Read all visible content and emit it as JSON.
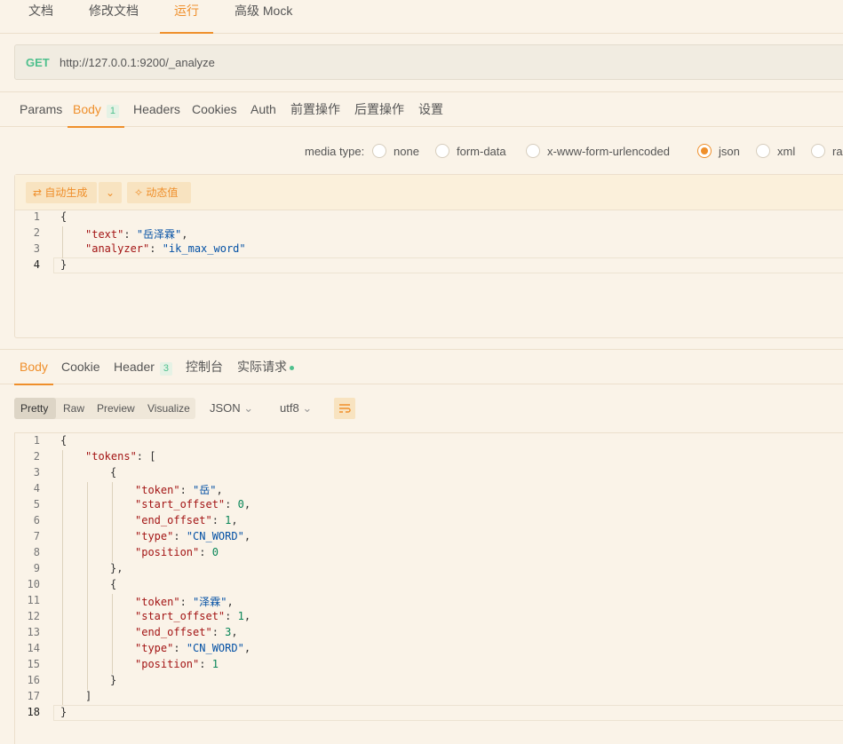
{
  "top_tabs": [
    "文档",
    "修改文档",
    "运行",
    "高级 Mock"
  ],
  "url_bar": {
    "method": "GET",
    "url": "http://127.0.0.1:9200/_analyze"
  },
  "request_tabs": {
    "params": "Params",
    "body": "Body",
    "body_count": "1",
    "headers": "Headers",
    "cookies": "Cookies",
    "auth": "Auth",
    "pre": "前置操作",
    "post": "后置操作",
    "settings": "设置"
  },
  "media_type": {
    "label": "media type:",
    "options": [
      "none",
      "form-data",
      "x-www-form-urlencoded",
      "json",
      "xml",
      "ra"
    ],
    "selected": "json"
  },
  "editor_toolbar": {
    "auto_generate": "自动生成",
    "dynamic_value": "动态值"
  },
  "request_body_lines": [
    {
      "ln": "1"
    },
    {
      "ln": "2",
      "key": "\"text\"",
      "val": "\"岳泽霖\""
    },
    {
      "ln": "3",
      "key": "\"analyzer\"",
      "val": "\"ik_max_word\""
    },
    {
      "ln": "4"
    }
  ],
  "response_tabs": {
    "body": "Body",
    "cookie": "Cookie",
    "header": "Header",
    "header_count": "3",
    "console": "控制台",
    "actual_request": "实际请求"
  },
  "view_modes": [
    "Pretty",
    "Raw",
    "Preview",
    "Visualize"
  ],
  "format": {
    "type": "JSON",
    "encoding": "utf8"
  },
  "response": {
    "key_tokens": "\"tokens\"",
    "key_token": "\"token\"",
    "key_start": "\"start_offset\"",
    "key_end": "\"end_offset\"",
    "key_type": "\"type\"",
    "key_position": "\"position\"",
    "tokens": [
      {
        "token": "\"岳\"",
        "start_offset": "0",
        "end_offset": "1",
        "type": "\"CN_WORD\"",
        "position": "0"
      },
      {
        "token": "\"泽霖\"",
        "start_offset": "1",
        "end_offset": "3",
        "type": "\"CN_WORD\"",
        "position": "1"
      }
    ]
  },
  "colors": {
    "accent": "#ef8f2b",
    "method_get": "#4fc08d",
    "background": "#faf3e8"
  },
  "icons": [
    "refresh-icon",
    "chevron-down-icon",
    "magic-icon",
    "wrap-lines-icon"
  ]
}
